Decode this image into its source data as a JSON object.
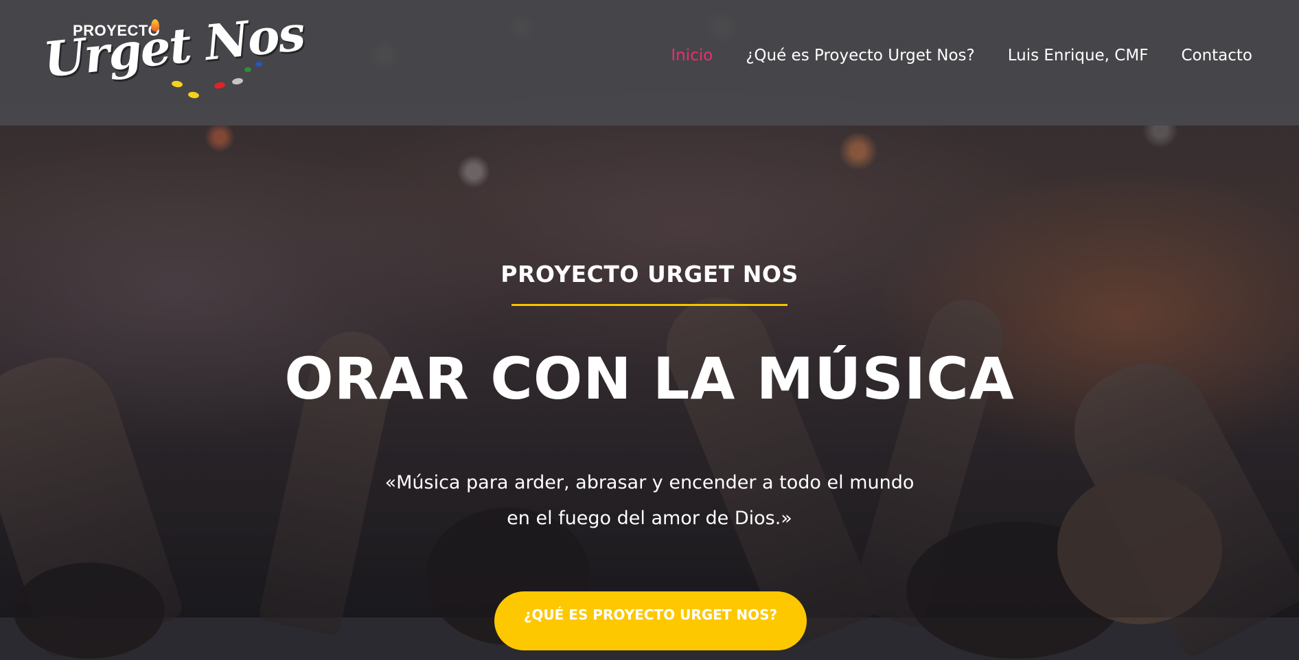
{
  "logo": {
    "small_text": "PROYECTO",
    "main_text": "Urget Nos"
  },
  "nav": {
    "items": [
      {
        "label": "Inicio",
        "active": true
      },
      {
        "label": "¿Qué es Proyecto Urget Nos?",
        "active": false
      },
      {
        "label": "Luis Enrique, CMF",
        "active": false
      },
      {
        "label": "Contacto",
        "active": false
      }
    ]
  },
  "hero": {
    "eyebrow": "PROYECTO URGET NOS",
    "headline": "ORAR CON LA MÚSICA",
    "quote_line1": "«Música para arder, abrasar y encender a todo el mundo",
    "quote_line2": "en el fuego del amor de Dios.»",
    "cta_label": "¿QUÉ ES PROYECTO URGET NOS?"
  },
  "colors": {
    "accent_active": "#ee2d6b",
    "accent_yellow": "#fdc800",
    "navbar_bg": "#48484c"
  }
}
